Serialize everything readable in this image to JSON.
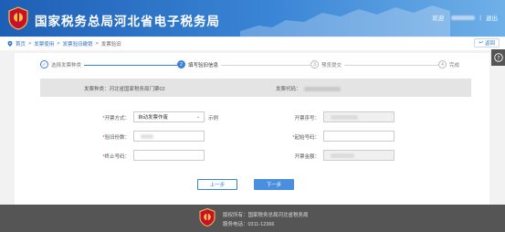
{
  "header": {
    "title": "国家税务总局河北省电子税务局",
    "welcome": "欢迎",
    "logout": "退出",
    "colors": {
      "accent": "#2a72c9",
      "header_start": "#1e5fb6",
      "header_end": "#6fb0e8"
    }
  },
  "breadcrumb": {
    "items": [
      "首页",
      "发票使用",
      "发票验旧缴销",
      "发票验旧"
    ],
    "separator": ">"
  },
  "back_label": "返回",
  "steps": [
    {
      "num": "1",
      "label": "选择发票种类",
      "state": "done"
    },
    {
      "num": "2",
      "label": "填写验旧信息",
      "state": "active"
    },
    {
      "num": "3",
      "label": "预览提交",
      "state": "pending"
    },
    {
      "num": "4",
      "label": "完成",
      "state": "pending"
    }
  ],
  "info": {
    "issuer_label": "发票种类：",
    "issuer_value": "河北省国家税务局门票02",
    "code_label": "发票代码："
  },
  "form": {
    "issue_type": {
      "label": "开票方式：",
      "value": "自动发票作废",
      "hint": "示例"
    },
    "issue_number": {
      "label": "开票序号："
    },
    "verify_count": {
      "label": "验旧份数："
    },
    "start_number": {
      "label": "起始号码："
    },
    "end_number": {
      "label": "终止号码："
    },
    "issue_amount": {
      "label": "开票金额："
    }
  },
  "buttons": {
    "prev": "上一步",
    "next": "下一步"
  },
  "footer": {
    "copyright": "版权所有：国家税务总局河北省税务局",
    "hotline": "服务电话：0311-12366"
  }
}
